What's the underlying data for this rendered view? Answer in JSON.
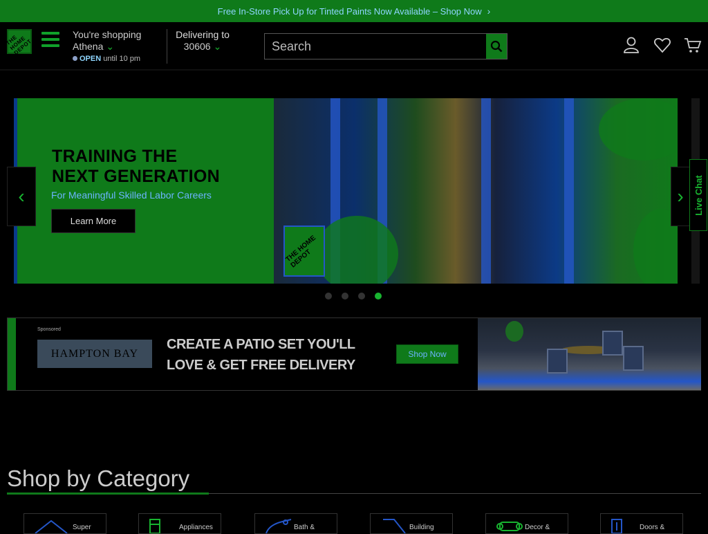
{
  "promo_bar": {
    "text": "Free In-Store Pick Up for Tinted Paints Now Available – Shop Now"
  },
  "header": {
    "logo_text": "THE HOME DEPOT",
    "store": {
      "line1": "You're shopping",
      "name": "Athena",
      "status": "OPEN",
      "hours": "until 10 pm"
    },
    "delivery": {
      "label": "Delivering to",
      "zip": "30606"
    },
    "search": {
      "placeholder": "Search"
    }
  },
  "hero": {
    "title_line1": "TRAINING THE",
    "title_line2": "NEXT GENERATION",
    "subtitle": "For Meaningful Skilled Labor Careers",
    "cta": "Learn More",
    "logo_text": "THE HOME DEPOT",
    "slide_count": 4,
    "active_slide": 4
  },
  "live_chat": {
    "label": "Live Chat"
  },
  "ad": {
    "sponsored": "Sponsored",
    "brand": "HAMPTON BAY",
    "headline_line1": "CREATE A PATIO SET YOU'LL",
    "headline_line2": "LOVE & GET FREE DELIVERY",
    "cta": "Shop Now"
  },
  "categories": {
    "title": "Shop by Category",
    "items": [
      {
        "label": "Super",
        "icon": "roof-icon"
      },
      {
        "label": "Appliances",
        "icon": "fridge-icon"
      },
      {
        "label": "Bath &",
        "icon": "faucet-icon"
      },
      {
        "label": "Building",
        "icon": "lumber-icon"
      },
      {
        "label": "Decor &",
        "icon": "sofa-icon"
      },
      {
        "label": "Doors &",
        "icon": "door-icon"
      }
    ]
  },
  "colors": {
    "brand_green": "#0f7a1a",
    "accent_blue": "#6cb4ff",
    "background": "#000000"
  }
}
